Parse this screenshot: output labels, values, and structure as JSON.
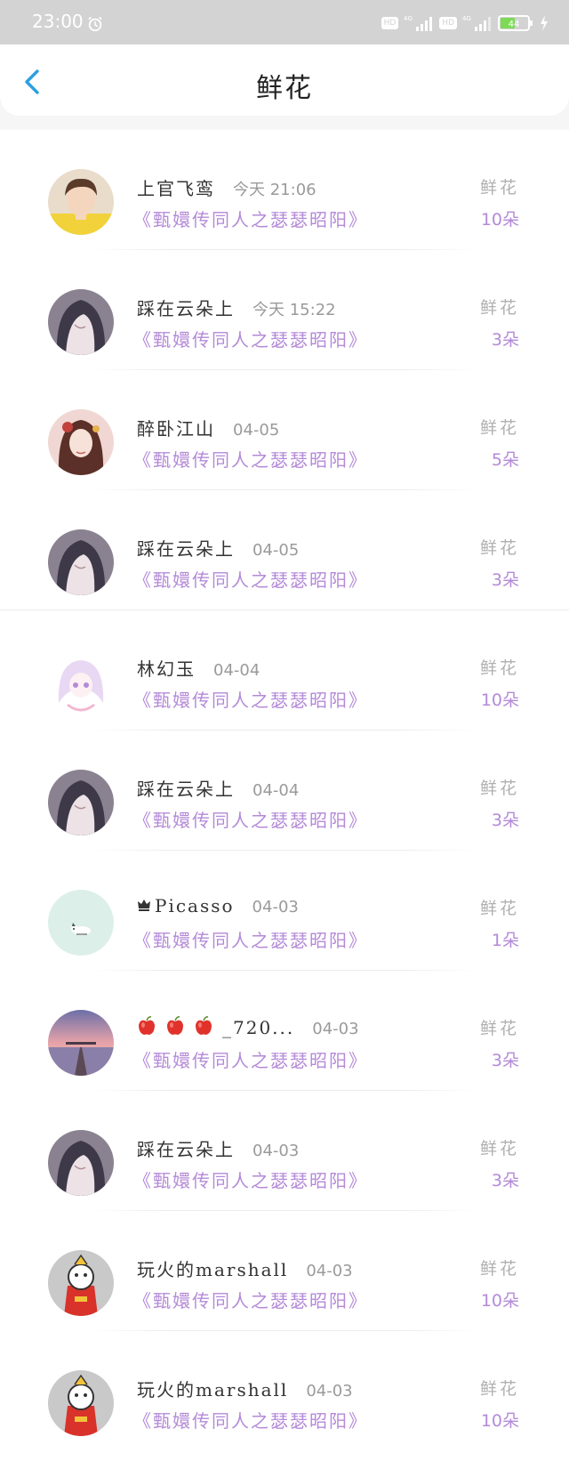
{
  "status_bar": {
    "time": "23:00",
    "hd1": "HD",
    "hd2": "HD",
    "battery": "44"
  },
  "header": {
    "title": "鲜花"
  },
  "items": [
    {
      "name": "上官飞鸾",
      "time": "今天 21:06",
      "book": "《甄嬛传同人之瑟瑟昭阳》",
      "gift": "鲜花",
      "count": "10朵",
      "avatar": "boy-yellow"
    },
    {
      "name": "踩在云朵上",
      "time": "今天 15:22",
      "book": "《甄嬛传同人之瑟瑟昭阳》",
      "gift": "鲜花",
      "count": "3朵",
      "avatar": "girl-dark"
    },
    {
      "name": "醉卧江山",
      "time": "04-05",
      "book": "《甄嬛传同人之瑟瑟昭阳》",
      "gift": "鲜花",
      "count": "5朵",
      "avatar": "ancient-lady"
    },
    {
      "name": "踩在云朵上",
      "time": "04-05",
      "book": "《甄嬛传同人之瑟瑟昭阳》",
      "gift": "鲜花",
      "count": "3朵",
      "avatar": "girl-dark"
    },
    {
      "name": "林幻玉",
      "time": "04-04",
      "book": "《甄嬛传同人之瑟瑟昭阳》",
      "gift": "鲜花",
      "count": "10朵",
      "avatar": "anime-pink"
    },
    {
      "name": "踩在云朵上",
      "time": "04-04",
      "book": "《甄嬛传同人之瑟瑟昭阳》",
      "gift": "鲜花",
      "count": "3朵",
      "avatar": "girl-dark"
    },
    {
      "name": "Picasso",
      "time": "04-03",
      "book": "《甄嬛传同人之瑟瑟昭阳》",
      "gift": "鲜花",
      "count": "1朵",
      "avatar": "mint-cat",
      "prefix_icon": "crown-icon"
    },
    {
      "name": "_720...",
      "time": "04-03",
      "book": "《甄嬛传同人之瑟瑟昭阳》",
      "gift": "鲜花",
      "count": "3朵",
      "avatar": "pier-sunset",
      "prefix_icon": "apple-icon"
    },
    {
      "name": "踩在云朵上",
      "time": "04-03",
      "book": "《甄嬛传同人之瑟瑟昭阳》",
      "gift": "鲜花",
      "count": "3朵",
      "avatar": "girl-dark"
    },
    {
      "name": "玩火的marshall",
      "time": "04-03",
      "book": "《甄嬛传同人之瑟瑟昭阳》",
      "gift": "鲜花",
      "count": "10朵",
      "avatar": "cartoon-red"
    },
    {
      "name": "玩火的marshall",
      "time": "04-03",
      "book": "《甄嬛传同人之瑟瑟昭阳》",
      "gift": "鲜花",
      "count": "10朵",
      "avatar": "cartoon-red"
    }
  ],
  "colors": {
    "accent_purple": "#b48ad8",
    "back_blue": "#2b9fe0",
    "status_bar_bg": "#d3d3d3"
  }
}
